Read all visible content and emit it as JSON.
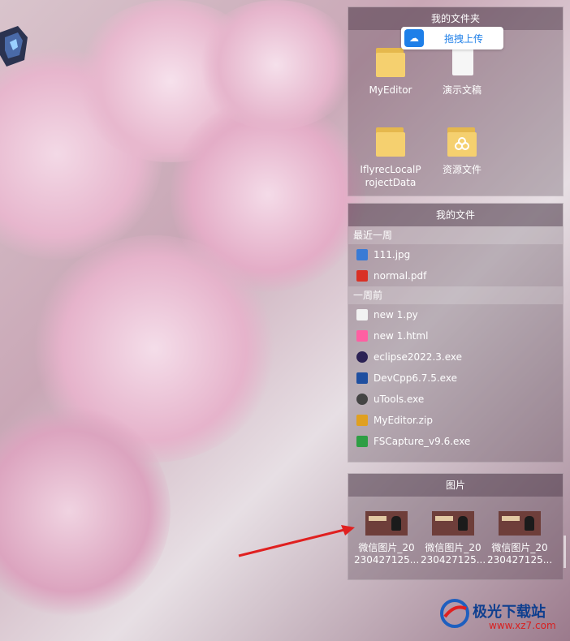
{
  "folder_panel": {
    "title": "我的文件夹",
    "upload_button": "拖拽上传",
    "items": [
      {
        "label": "MyEditor",
        "type": "folder"
      },
      {
        "label": "演示文稿",
        "type": "document"
      },
      {
        "label": "IflyrecLocalProjectData",
        "type": "folder"
      },
      {
        "label": "资源文件",
        "type": "resource-folder"
      }
    ]
  },
  "files_panel": {
    "title": "我的文件",
    "recent_week": {
      "label": "最近一周",
      "files": [
        {
          "name": "111.jpg",
          "icon": "image-icon",
          "color": "#3a7bd5"
        },
        {
          "name": "normal.pdf",
          "icon": "pdf-icon",
          "color": "#d93025"
        }
      ]
    },
    "older": {
      "label": "一周前",
      "files": [
        {
          "name": "new 1.py",
          "icon": "text-file-icon",
          "color": "#f2f2f2"
        },
        {
          "name": "new 1.html",
          "icon": "html-file-icon",
          "color": "#ff5fa2"
        },
        {
          "name": "eclipse2022.3.exe",
          "icon": "eclipse-icon",
          "color": "#2c2255"
        },
        {
          "name": "DevCpp6.7.5.exe",
          "icon": "devcpp-icon",
          "color": "#1f4fa0"
        },
        {
          "name": "uTools.exe",
          "icon": "utools-icon",
          "color": "#444444"
        },
        {
          "name": "MyEditor.zip",
          "icon": "zip-icon",
          "color": "#e0a020"
        },
        {
          "name": "FSCapture_v9.6.exe",
          "icon": "fscapture-icon",
          "color": "#2e9e44"
        }
      ]
    }
  },
  "pictures_panel": {
    "title": "图片",
    "items": [
      {
        "line1": "微信图片_20",
        "line2": "230427125..."
      },
      {
        "line1": "微信图片_20",
        "line2": "230427125..."
      },
      {
        "line1": "微信图片_20",
        "line2": "230427125..."
      }
    ]
  },
  "watermark": {
    "text": "极光下载站",
    "url": "www.xz7.com"
  },
  "colors": {
    "accent": "#1e7fe8",
    "arrow": "#e02020"
  }
}
